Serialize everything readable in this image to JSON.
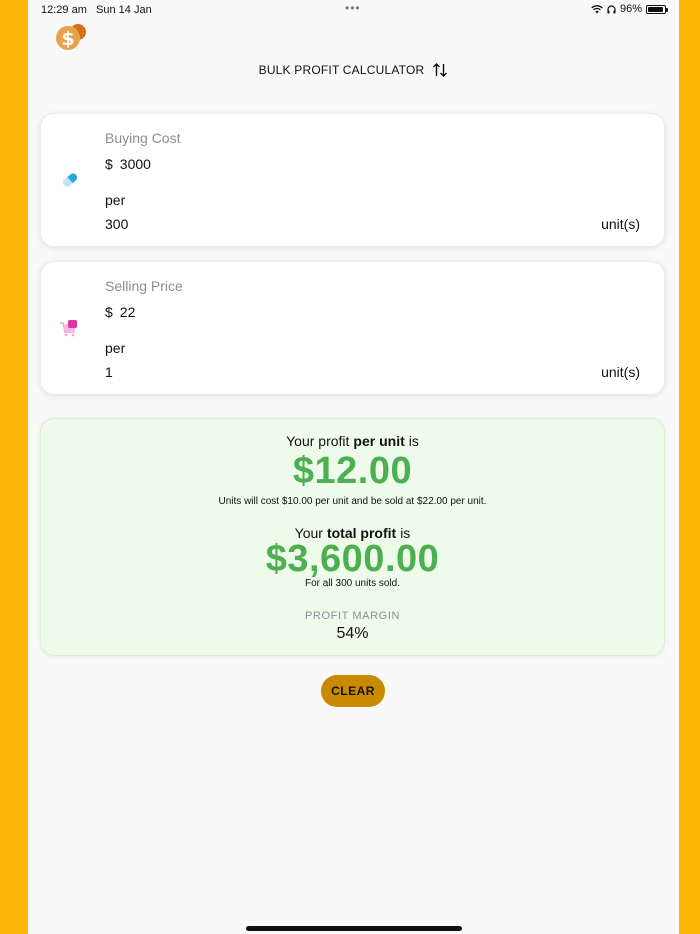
{
  "status_bar": {
    "time": "12:29 am",
    "date": "Sun 14 Jan",
    "battery": "96%",
    "battery_level": 0.96,
    "icons": [
      "wifi-icon",
      "headphones-icon",
      "battery-icon"
    ]
  },
  "header": {
    "title": "BULK PROFIT CALCULATOR",
    "swap_icon": "swap-vertical-icon"
  },
  "buying_card": {
    "label": "Buying Cost",
    "currency": "$",
    "amount": "3000",
    "per_label": "per",
    "quantity": "300",
    "unit_label": "unit(s)",
    "icon": "pill-icon"
  },
  "selling_card": {
    "label": "Selling Price",
    "currency": "$",
    "amount": "22",
    "per_label": "per",
    "quantity": "1",
    "unit_label": "unit(s)",
    "icon": "cart-icon"
  },
  "result": {
    "unit_prefix": "Your profit",
    "unit_bold": "per unit",
    "unit_suffix": "is",
    "unit_profit": "$12.00",
    "unit_note": "Units will cost $10.00 per unit and be sold at $22.00 per unit.",
    "total_prefix": "Your",
    "total_bold": "total profit",
    "total_suffix": "is",
    "total_profit": "$3,600.00",
    "total_note": "For all 300 units sold.",
    "margin_label": "PROFIT MARGIN",
    "margin_value": "54%"
  },
  "actions": {
    "clear_label": "CLEAR"
  },
  "colors": {
    "frame": "#FDB706",
    "accent_green": "#4CAF50",
    "button": "#C98A00",
    "result_bg": "#EFFBEA"
  }
}
